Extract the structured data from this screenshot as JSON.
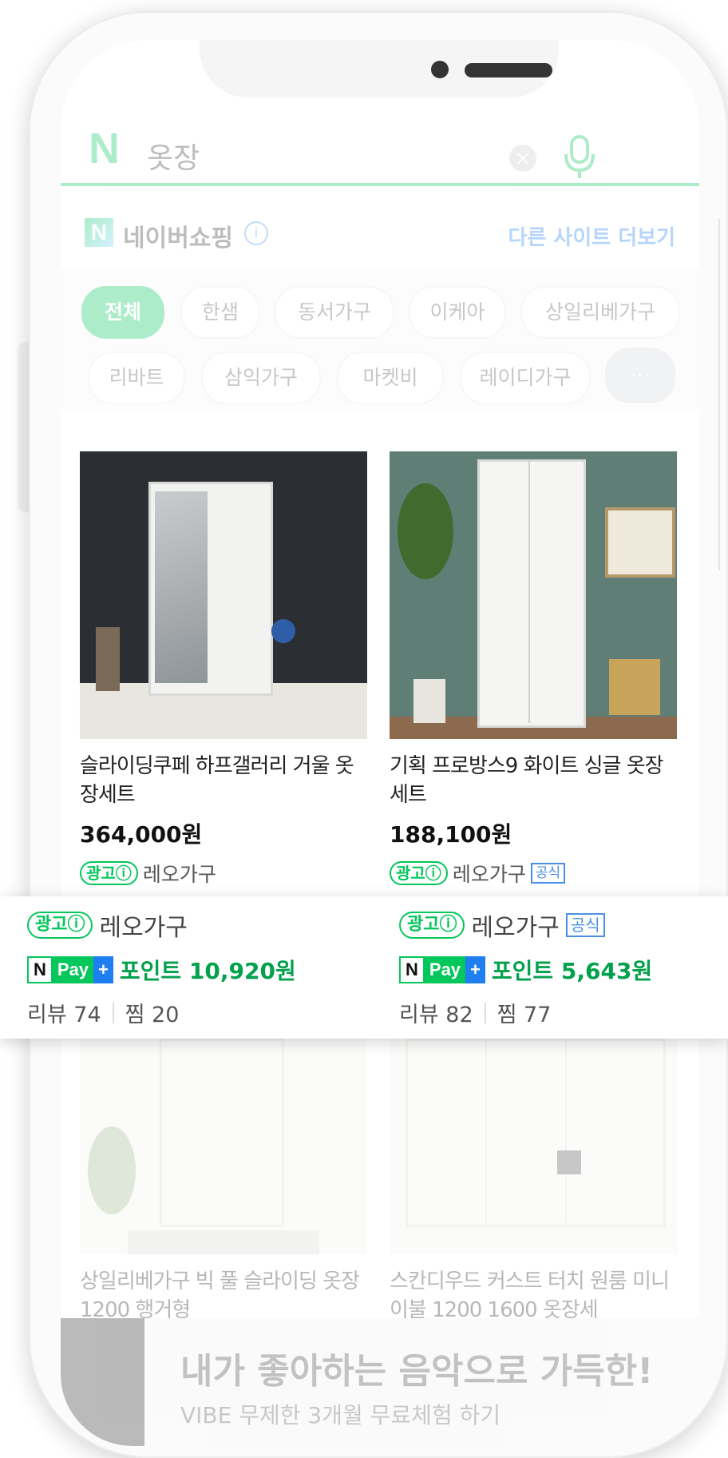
{
  "search": {
    "logo": "N",
    "query": "옷장",
    "clear": "×"
  },
  "shopping": {
    "logo": "N",
    "title": "네이버쇼핑",
    "info": "i",
    "more": "다른 사이트 더보기"
  },
  "chips": [
    "전체",
    "한샘",
    "동서가구",
    "이케아",
    "상일리베가구",
    "리바트",
    "삼익가구",
    "마켓비",
    "레이디가구",
    "···"
  ],
  "products": [
    {
      "name": "슬라이딩쿠페 하프갤러리 거울 옷장세트",
      "price": "364,000원",
      "ad": "광고ⓘ",
      "seller": "레오가구",
      "official": "",
      "points": "포인트 10,920원",
      "reviews": "리뷰 74",
      "zzim": "찜 20"
    },
    {
      "name": "기획 프로방스9 화이트 싱글 옷장세트",
      "price": "188,100원",
      "ad": "광고ⓘ",
      "seller": "레오가구",
      "official": "공식",
      "points": "포인트 5,643원",
      "reviews": "리뷰 82",
      "zzim": "찜 77"
    },
    {
      "name": "상일리베가구 빅 풀 슬라이딩 옷장 1200 행거형"
    },
    {
      "name": "스칸디우드 커스트 터치 원룸 미니 이불 1200 1600 옷장세"
    }
  ],
  "npay": {
    "n": "N",
    "pay": "Pay",
    "plus": "+"
  },
  "bottom_ad": {
    "headline": "내가 좋아하는 음악으로 가득한!",
    "sub": "VIBE 무제한 3개월 무료체험 하기"
  }
}
